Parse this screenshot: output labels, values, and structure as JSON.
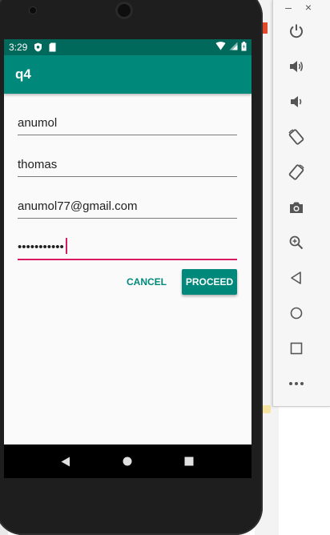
{
  "status_bar": {
    "time": "3:29",
    "icons": [
      "shield-icon",
      "sd-card-icon",
      "wifi-icon",
      "signal-icon",
      "battery-icon"
    ]
  },
  "app_bar": {
    "title": "q4"
  },
  "form": {
    "first_name": "anumol",
    "last_name": "thomas",
    "email": "anumol77@gmail.com",
    "password_masked": "•••••••••••"
  },
  "buttons": {
    "cancel": "CANCEL",
    "proceed": "PROCEED"
  },
  "nav_bar": {
    "icons": [
      "back-icon",
      "home-icon",
      "recents-icon"
    ]
  },
  "emulator_toolbar": {
    "window_controls": {
      "minimize": "–",
      "close": "×"
    },
    "icons": [
      "power-icon",
      "volume-up-icon",
      "volume-down-icon",
      "rotate-left-icon",
      "rotate-right-icon",
      "camera-icon",
      "zoom-icon",
      "back-icon",
      "home-icon",
      "overview-icon",
      "more-icon"
    ]
  },
  "colors": {
    "status_bar": "#00695c",
    "app_bar": "#00897b",
    "accent": "#d81b60",
    "button": "#00897b"
  }
}
